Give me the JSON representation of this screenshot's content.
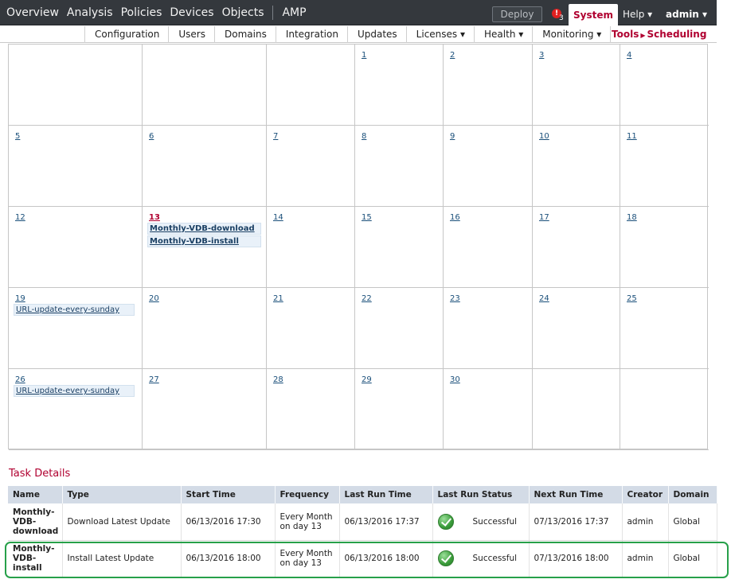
{
  "topnav": {
    "items": [
      "Overview",
      "Analysis",
      "Policies",
      "Devices",
      "Objects",
      "AMP"
    ],
    "deploy_label": "Deploy",
    "alert_count": "3",
    "system_label": "System",
    "help_label": "Help ▾",
    "admin_label": "admin ▾"
  },
  "subnav": {
    "items": [
      "Configuration",
      "Users",
      "Domains",
      "Integration",
      "Updates",
      "Licenses ▾",
      "Health ▾",
      "Monitoring ▾"
    ],
    "breadcrumb": {
      "parent": "Tools",
      "current": "Scheduling"
    }
  },
  "calendar": {
    "today": "13",
    "cells": [
      {
        "day": "",
        "events": []
      },
      {
        "day": "",
        "events": []
      },
      {
        "day": "",
        "events": []
      },
      {
        "day": "1",
        "events": []
      },
      {
        "day": "2",
        "events": []
      },
      {
        "day": "3",
        "events": []
      },
      {
        "day": "4",
        "events": []
      },
      {
        "day": "5",
        "events": []
      },
      {
        "day": "6",
        "events": []
      },
      {
        "day": "7",
        "events": []
      },
      {
        "day": "8",
        "events": []
      },
      {
        "day": "9",
        "events": []
      },
      {
        "day": "10",
        "events": []
      },
      {
        "day": "11",
        "events": []
      },
      {
        "day": "12",
        "events": []
      },
      {
        "day": "13",
        "events": [
          "Monthly-VDB-download",
          "Monthly-VDB-install"
        ]
      },
      {
        "day": "14",
        "events": []
      },
      {
        "day": "15",
        "events": []
      },
      {
        "day": "16",
        "events": []
      },
      {
        "day": "17",
        "events": []
      },
      {
        "day": "18",
        "events": []
      },
      {
        "day": "19",
        "events": [
          "URL-update-every-sunday"
        ]
      },
      {
        "day": "20",
        "events": []
      },
      {
        "day": "21",
        "events": []
      },
      {
        "day": "22",
        "events": []
      },
      {
        "day": "23",
        "events": []
      },
      {
        "day": "24",
        "events": []
      },
      {
        "day": "25",
        "events": []
      },
      {
        "day": "26",
        "events": [
          "URL-update-every-sunday"
        ]
      },
      {
        "day": "27",
        "events": []
      },
      {
        "day": "28",
        "events": []
      },
      {
        "day": "29",
        "events": []
      },
      {
        "day": "30",
        "events": []
      },
      {
        "day": "",
        "events": []
      },
      {
        "day": "",
        "events": []
      }
    ]
  },
  "task_details": {
    "title": "Task Details",
    "columns": [
      "Name",
      "Type",
      "Start Time",
      "Frequency",
      "Last Run Time",
      "Last Run Status",
      "Next Run Time",
      "Creator",
      "Domain"
    ],
    "rows": [
      {
        "name": "Monthly-VDB-download",
        "type": "Download Latest Update",
        "start_time": "06/13/2016 17:30",
        "frequency": "Every Month on day 13",
        "last_run_time": "06/13/2016 17:37",
        "last_run_status": "Successful",
        "next_run_time": "07/13/2016 17:37",
        "creator": "admin",
        "domain": "Global"
      },
      {
        "name": "Monthly-VDB-install",
        "type": "Install Latest Update",
        "start_time": "06/13/2016 18:00",
        "frequency": "Every Month on day 13",
        "last_run_time": "06/13/2016 18:00",
        "last_run_status": "Successful",
        "next_run_time": "07/13/2016 18:00",
        "creator": "admin",
        "domain": "Global"
      }
    ]
  },
  "colors": {
    "topbar_bg": "#34383d",
    "accent_red": "#b00030",
    "link_blue": "#1a4f7a",
    "table_header_bg": "#d3dbe6",
    "highlight_green": "#27a04a",
    "success_green": "#3a9c3a"
  },
  "icons": {
    "alert": "alert-icon",
    "status_ok": "check-circle-icon",
    "dropdown": "chevron-down-icon",
    "breadcrumb_arrow": "triangle-right-icon"
  }
}
